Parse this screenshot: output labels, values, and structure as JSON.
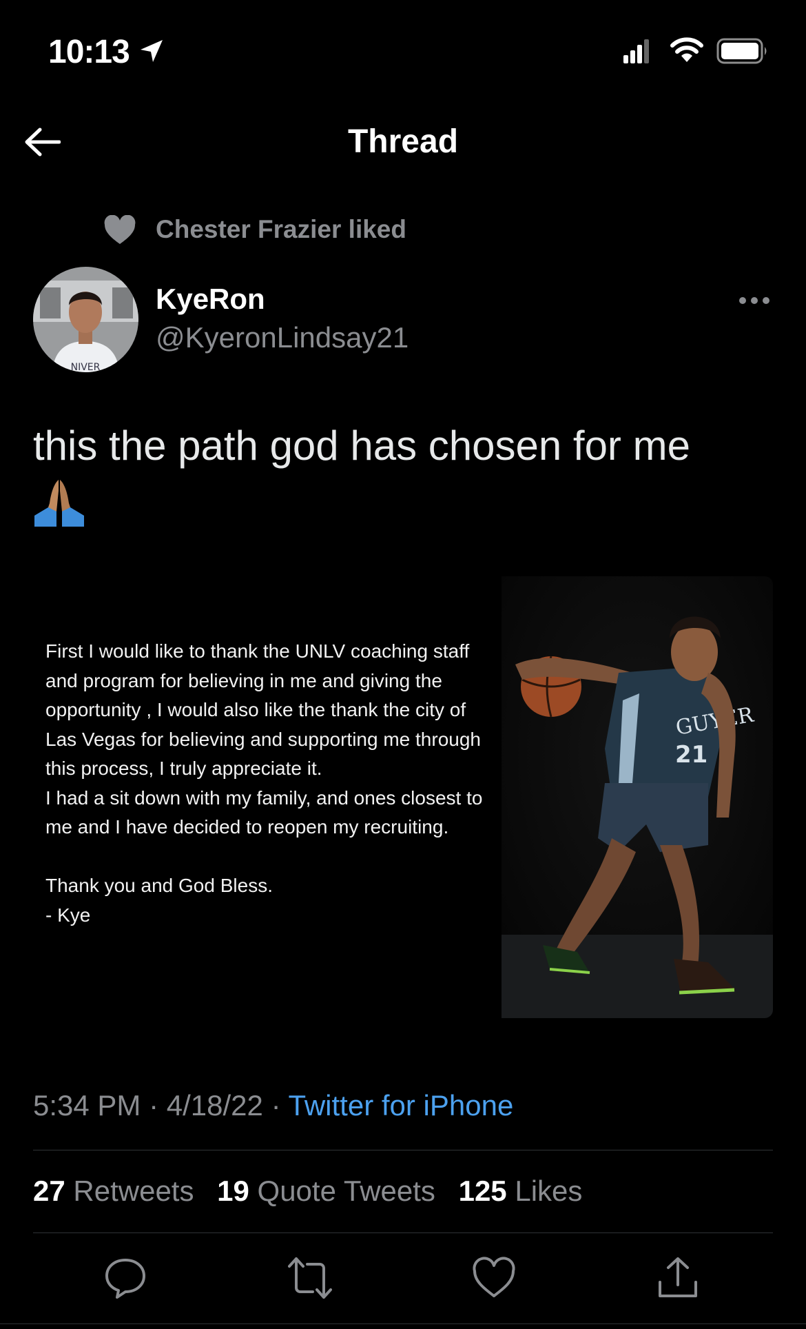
{
  "status_bar": {
    "time": "10:13"
  },
  "header": {
    "title": "Thread"
  },
  "social_context": {
    "text": "Chester Frazier liked"
  },
  "author": {
    "name": "KyeRon",
    "handle": "@KyeronLindsay21"
  },
  "tweet": {
    "text": "this the path god has chosen for me",
    "emoji": "🙏🏽",
    "statement": {
      "paragraphs": [
        "First I would like to thank the UNLV coaching staff and program for believing in me and giving the opportunity , I would also like the thank the city of Las Vegas for believing and supporting me through this process, I truly appreciate it.",
        "I had a sit down with my family, and ones closest to me and I have decided to reopen my recruiting.",
        "",
        "Thank you and God Bless.",
        "- Kye"
      ]
    }
  },
  "meta": {
    "time": "5:34 PM",
    "separator": "·",
    "date": "4/18/22",
    "source": "Twitter for iPhone"
  },
  "stats": {
    "retweets_count": "27",
    "retweets_label": "Retweets",
    "quotes_count": "19",
    "quotes_label": "Quote Tweets",
    "likes_count": "125",
    "likes_label": "Likes"
  },
  "colors": {
    "background": "#000000",
    "accent": "#4ca1ef",
    "muted": "#8b8d91",
    "divider": "#2f3336"
  },
  "icons": [
    "location-arrow-icon",
    "cellular-signal-icon",
    "wifi-icon",
    "battery-icon",
    "back-arrow-icon",
    "heart-icon",
    "more-icon",
    "reply-icon",
    "retweet-icon",
    "like-icon",
    "share-icon"
  ]
}
